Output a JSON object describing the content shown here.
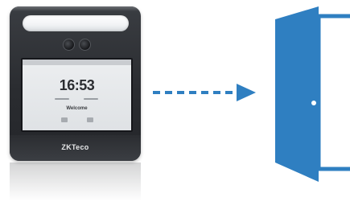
{
  "device": {
    "screen_time": "16:53",
    "screen_welcome": "Welcome",
    "brand_logo": "ZKTeco"
  },
  "colors": {
    "accent": "#2f7fc1",
    "device_body": "#2b2d31",
    "screen": "#e4e6e9"
  },
  "icons": {
    "arrow": "dashed-right-arrow-icon",
    "door": "open-door-icon"
  }
}
